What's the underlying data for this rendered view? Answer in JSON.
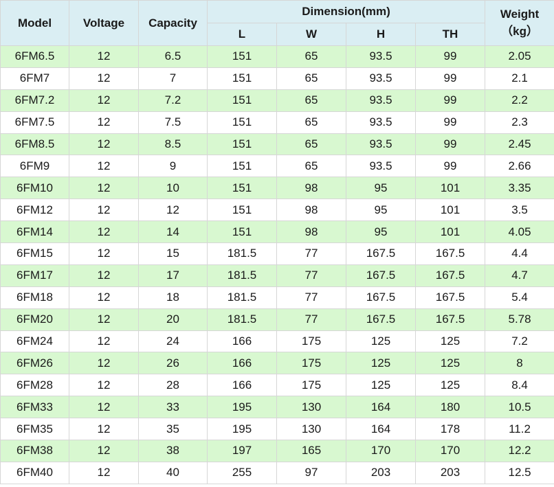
{
  "header": {
    "model": "Model",
    "voltage": "Voltage",
    "capacity": "Capacity",
    "dimension": "Dimension(mm)",
    "weight": "Weight",
    "weight_unit": "（kg）",
    "sub": {
      "l": "L",
      "w": "W",
      "h": "H",
      "th": "TH"
    }
  },
  "rows": [
    {
      "model": "6FM6.5",
      "voltage": "12",
      "capacity": "6.5",
      "l": "151",
      "w": "65",
      "h": "93.5",
      "th": "99",
      "weight": "2.05"
    },
    {
      "model": "6FM7",
      "voltage": "12",
      "capacity": "7",
      "l": "151",
      "w": "65",
      "h": "93.5",
      "th": "99",
      "weight": "2.1"
    },
    {
      "model": "6FM7.2",
      "voltage": "12",
      "capacity": "7.2",
      "l": "151",
      "w": "65",
      "h": "93.5",
      "th": "99",
      "weight": "2.2"
    },
    {
      "model": "6FM7.5",
      "voltage": "12",
      "capacity": "7.5",
      "l": "151",
      "w": "65",
      "h": "93.5",
      "th": "99",
      "weight": "2.3"
    },
    {
      "model": "6FM8.5",
      "voltage": "12",
      "capacity": "8.5",
      "l": "151",
      "w": "65",
      "h": "93.5",
      "th": "99",
      "weight": "2.45"
    },
    {
      "model": "6FM9",
      "voltage": "12",
      "capacity": "9",
      "l": "151",
      "w": "65",
      "h": "93.5",
      "th": "99",
      "weight": "2.66"
    },
    {
      "model": "6FM10",
      "voltage": "12",
      "capacity": "10",
      "l": "151",
      "w": "98",
      "h": "95",
      "th": "101",
      "weight": "3.35"
    },
    {
      "model": "6FM12",
      "voltage": "12",
      "capacity": "12",
      "l": "151",
      "w": "98",
      "h": "95",
      "th": "101",
      "weight": "3.5"
    },
    {
      "model": "6FM14",
      "voltage": "12",
      "capacity": "14",
      "l": "151",
      "w": "98",
      "h": "95",
      "th": "101",
      "weight": "4.05"
    },
    {
      "model": "6FM15",
      "voltage": "12",
      "capacity": "15",
      "l": "181.5",
      "w": "77",
      "h": "167.5",
      "th": "167.5",
      "weight": "4.4"
    },
    {
      "model": "6FM17",
      "voltage": "12",
      "capacity": "17",
      "l": "181.5",
      "w": "77",
      "h": "167.5",
      "th": "167.5",
      "weight": "4.7"
    },
    {
      "model": "6FM18",
      "voltage": "12",
      "capacity": "18",
      "l": "181.5",
      "w": "77",
      "h": "167.5",
      "th": "167.5",
      "weight": "5.4"
    },
    {
      "model": "6FM20",
      "voltage": "12",
      "capacity": "20",
      "l": "181.5",
      "w": "77",
      "h": "167.5",
      "th": "167.5",
      "weight": "5.78"
    },
    {
      "model": "6FM24",
      "voltage": "12",
      "capacity": "24",
      "l": "166",
      "w": "175",
      "h": "125",
      "th": "125",
      "weight": "7.2"
    },
    {
      "model": "6FM26",
      "voltage": "12",
      "capacity": "26",
      "l": "166",
      "w": "175",
      "h": "125",
      "th": "125",
      "weight": "8"
    },
    {
      "model": "6FM28",
      "voltage": "12",
      "capacity": "28",
      "l": "166",
      "w": "175",
      "h": "125",
      "th": "125",
      "weight": "8.4"
    },
    {
      "model": "6FM33",
      "voltage": "12",
      "capacity": "33",
      "l": "195",
      "w": "130",
      "h": "164",
      "th": "180",
      "weight": "10.5"
    },
    {
      "model": "6FM35",
      "voltage": "12",
      "capacity": "35",
      "l": "195",
      "w": "130",
      "h": "164",
      "th": "178",
      "weight": "11.2"
    },
    {
      "model": "6FM38",
      "voltage": "12",
      "capacity": "38",
      "l": "197",
      "w": "165",
      "h": "170",
      "th": "170",
      "weight": "12.2"
    },
    {
      "model": "6FM40",
      "voltage": "12",
      "capacity": "40",
      "l": "255",
      "w": "97",
      "h": "203",
      "th": "203",
      "weight": "12.5"
    }
  ]
}
